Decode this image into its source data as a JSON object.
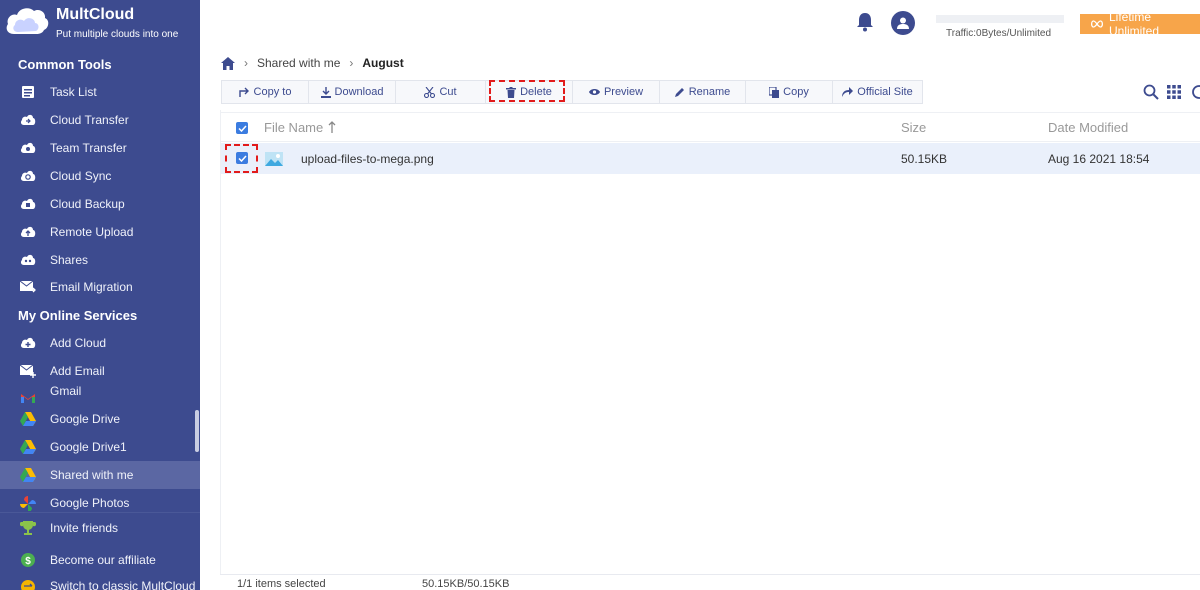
{
  "app": {
    "name": "MultCloud",
    "tagline": "Put multiple clouds into one"
  },
  "sidebar": {
    "common_tools_title": "Common Tools",
    "common_tools": [
      {
        "label": "Task List",
        "icon": "task-list-icon"
      },
      {
        "label": "Cloud Transfer",
        "icon": "cloud-transfer-icon"
      },
      {
        "label": "Team Transfer",
        "icon": "team-transfer-icon"
      },
      {
        "label": "Cloud Sync",
        "icon": "cloud-sync-icon"
      },
      {
        "label": "Cloud Backup",
        "icon": "cloud-backup-icon"
      },
      {
        "label": "Remote Upload",
        "icon": "remote-upload-icon"
      },
      {
        "label": "Shares",
        "icon": "shares-icon"
      },
      {
        "label": "Email Migration",
        "icon": "email-migration-icon"
      }
    ],
    "online_services_title": "My Online Services",
    "online_services": [
      {
        "label": "Add Cloud",
        "icon": "add-cloud-icon"
      },
      {
        "label": "Add Email",
        "icon": "add-email-icon"
      },
      {
        "label": "Gmail",
        "icon": "gmail-icon"
      },
      {
        "label": "Google Drive",
        "icon": "google-drive-icon"
      },
      {
        "label": "Google Drive1",
        "icon": "google-drive-icon"
      },
      {
        "label": "Shared with me",
        "icon": "google-drive-icon"
      },
      {
        "label": "Google Photos",
        "icon": "google-photos-icon"
      }
    ],
    "bottom_links": [
      {
        "label": "Invite friends",
        "icon": "trophy-icon"
      },
      {
        "label": "Become our affiliate",
        "icon": "dollar-icon"
      },
      {
        "label": "Switch to classic MultCloud",
        "icon": "switch-icon"
      }
    ]
  },
  "header": {
    "traffic": "Traffic:0Bytes/Unlimited",
    "lifetime_label": "Lifetime Unlimited"
  },
  "breadcrumb": {
    "items": [
      "Shared with me",
      "August"
    ]
  },
  "toolbar": {
    "buttons": [
      {
        "label": "Copy to",
        "icon": "copy-to-icon"
      },
      {
        "label": "Download",
        "icon": "download-icon"
      },
      {
        "label": "Cut",
        "icon": "cut-icon"
      },
      {
        "label": "Delete",
        "icon": "trash-icon"
      },
      {
        "label": "Preview",
        "icon": "eye-icon"
      },
      {
        "label": "Rename",
        "icon": "pencil-icon"
      },
      {
        "label": "Copy",
        "icon": "copy-icon"
      },
      {
        "label": "Official Site",
        "icon": "share-arrow-icon"
      }
    ]
  },
  "table": {
    "columns": {
      "name": "File Name",
      "size": "Size",
      "date": "Date Modified"
    },
    "rows": [
      {
        "name": "upload-files-to-mega.png",
        "size": "50.15KB",
        "date": "Aug 16 2021 18:54",
        "selected": true
      }
    ]
  },
  "footer": {
    "selection": "1/1 items selected",
    "size": "50.15KB/50.15KB"
  },
  "colors": {
    "sidebar": "#3d4b8f",
    "accent": "#3b7ce0",
    "lifetime": "#f7a54a",
    "highlight": "#e21b1b"
  }
}
